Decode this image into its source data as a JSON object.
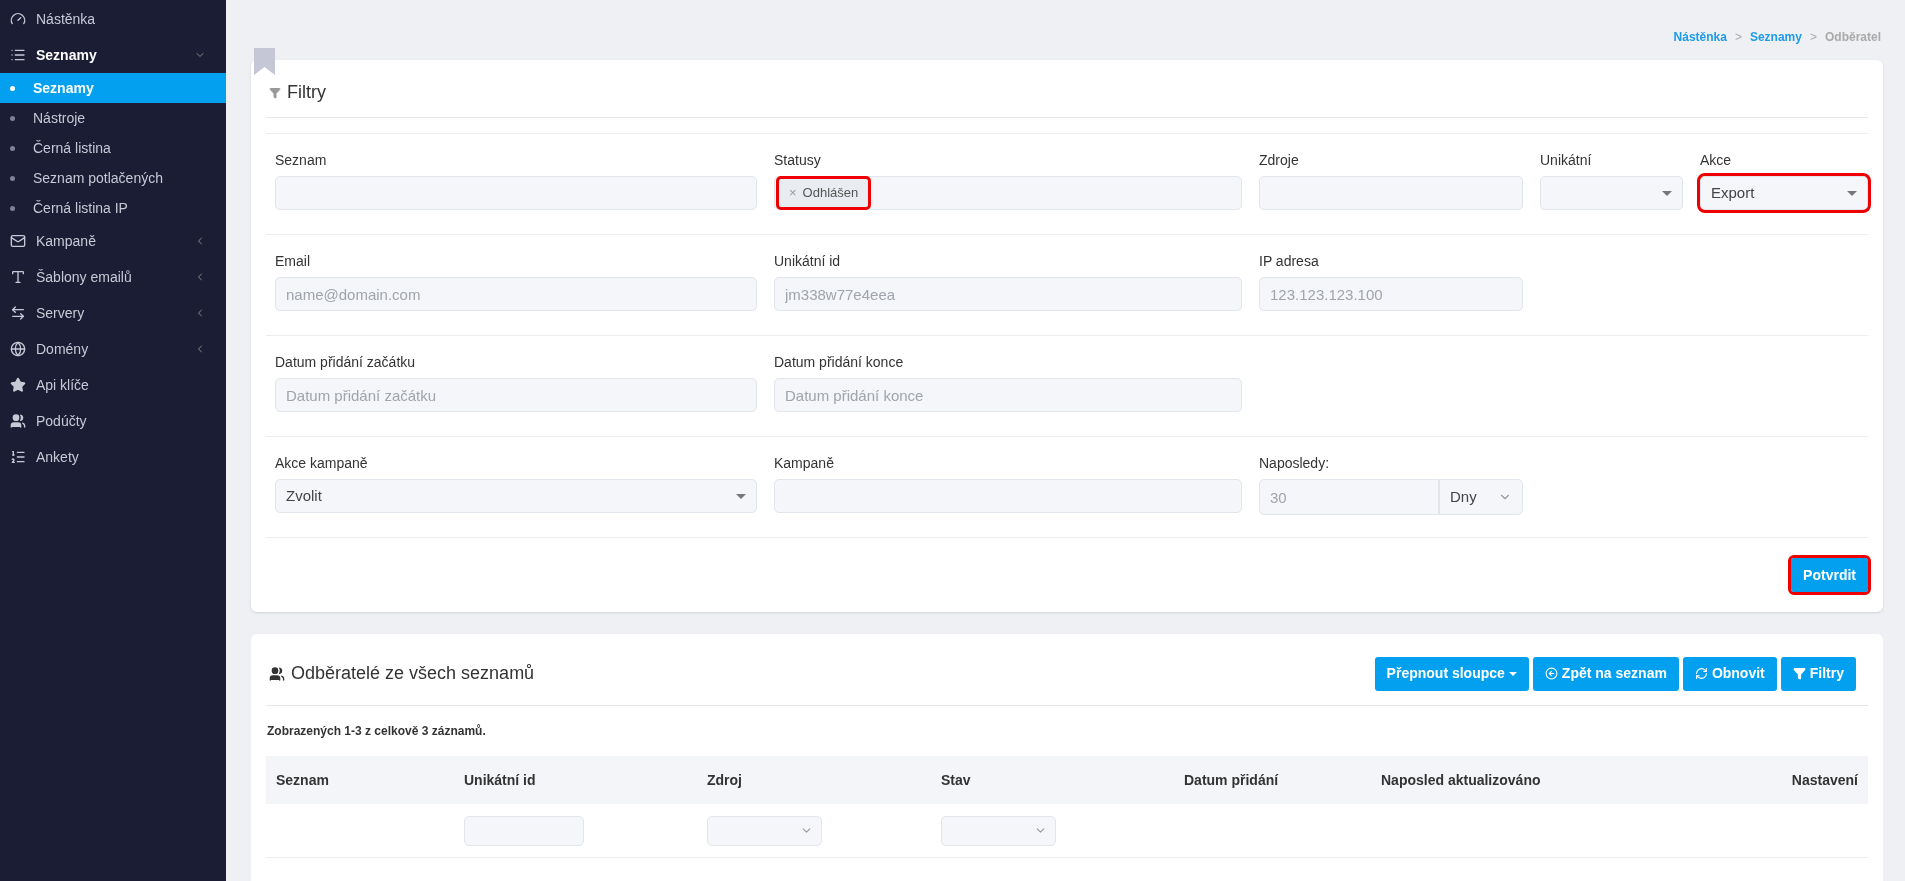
{
  "sidebar": {
    "items": [
      {
        "label": "Nástěnka",
        "selected": false
      },
      {
        "label": "Seznamy",
        "selected": true,
        "expanded": true,
        "children": [
          {
            "label": "Seznamy",
            "selected": true
          },
          {
            "label": "Nástroje",
            "selected": false
          },
          {
            "label": "Černá listina",
            "selected": false
          },
          {
            "label": "Seznam potlačených",
            "selected": false
          },
          {
            "label": "Černá listina IP",
            "selected": false
          }
        ]
      },
      {
        "label": "Kampaně",
        "selected": false,
        "expanded": false
      },
      {
        "label": "Šablony emailů",
        "selected": false,
        "expanded": false
      },
      {
        "label": "Servery",
        "selected": false,
        "expanded": false
      },
      {
        "label": "Domény",
        "selected": false,
        "expanded": false
      },
      {
        "label": "Api klíče",
        "selected": false
      },
      {
        "label": "Podúčty",
        "selected": false
      },
      {
        "label": "Ankety",
        "selected": false
      }
    ]
  },
  "breadcrumb": [
    {
      "label": "Nástěnka",
      "link": true
    },
    {
      "separator": ">",
      "label": "Seznamy",
      "link": true
    },
    {
      "separator": ">",
      "label": "Odběratel",
      "link": false
    }
  ],
  "filters": {
    "title": "Filtry",
    "rows": [
      [
        {
          "label": "Seznam",
          "kind": "text"
        },
        {
          "label": "Statusy",
          "kind": "tags",
          "tags": [
            {
              "label": "Odhlášen",
              "remove": "×",
              "highlighted": true
            }
          ]
        },
        {
          "label": "Zdroje",
          "kind": "text"
        },
        {
          "label": "Unikátní",
          "kind": "select"
        },
        {
          "label": "Akce",
          "kind": "select",
          "value": "Export",
          "highlighted": true
        }
      ],
      [
        {
          "label": "Email",
          "kind": "text",
          "placeholder": "name@domain.com"
        },
        {
          "label": "Unikátní id",
          "kind": "text",
          "placeholder": "jm338w77e4eea"
        },
        {
          "label": "IP adresa",
          "kind": "text",
          "placeholder": "123.123.123.100"
        }
      ],
      [
        {
          "label": "Datum přidání začátku",
          "kind": "text",
          "placeholder": "Datum přidání začátku"
        },
        {
          "label": "Datum přidání konce",
          "kind": "text",
          "placeholder": "Datum přidání konce"
        }
      ],
      [
        {
          "label": "Akce kampaně",
          "kind": "select",
          "value": "Zvolit"
        },
        {
          "label": "Kampaně",
          "kind": "text"
        },
        {
          "label": "Naposledy:",
          "kind": "number-unit",
          "placeholder": "30",
          "unit": "Dny"
        }
      ]
    ],
    "submit": {
      "label": "Potvrdit",
      "highlighted": true
    }
  },
  "subscribers": {
    "title": "Odběratelé ze všech seznamů",
    "buttons": [
      {
        "label": "Přepnout sloupce",
        "kind": "dropdown"
      },
      {
        "label": "Zpět na seznam",
        "kind": "back"
      },
      {
        "label": "Obnovit",
        "kind": "refresh"
      },
      {
        "label": "Filtry",
        "kind": "filter"
      }
    ],
    "summary": "Zobrazených 1-3 z celkově 3 záznamů.",
    "columns": [
      {
        "label": "Seznam",
        "kind": "none"
      },
      {
        "label": "Unikátní id",
        "kind": "text"
      },
      {
        "label": "Zdroj",
        "kind": "select"
      },
      {
        "label": "Stav",
        "kind": "select"
      },
      {
        "label": "Datum přidání",
        "kind": "none"
      },
      {
        "label": "Naposled aktualizováno",
        "kind": "none"
      },
      {
        "label": "Nastavení",
        "kind": "none"
      }
    ]
  }
}
